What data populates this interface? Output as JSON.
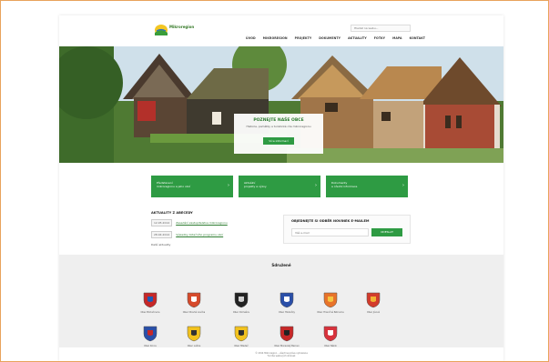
{
  "header": {
    "logo_text": "Mikroregion",
    "search_placeholder": "Hledat na webu...",
    "nav": [
      "ÚVOD",
      "MIKROREGION",
      "PROJEKTY",
      "DOKUMENTY",
      "AKTUALITY",
      "FOTKY",
      "MAPA",
      "KONTAKT"
    ]
  },
  "hero": {
    "title": "POZNEJTE NAŠE OBCE",
    "subtitle": "Historie, památky a turistické cíle mikroregionu",
    "button": "Více informací"
  },
  "tiles": [
    {
      "line1": "Představení",
      "line2": "mikroregionu a jeho obcí"
    },
    {
      "line1": "Aktuální",
      "line2": "projekty a výzvy"
    },
    {
      "line1": "Dokumenty",
      "line2": "a úřední informace"
    }
  ],
  "news": {
    "heading": "AKTUALITY Z ABECEDY",
    "items": [
      {
        "date": "12.05.2014",
        "title": "Zasedání zastupitelstva mikroregionu"
      },
      {
        "date": "28.04.2014",
        "title": "Výsledky dotačního programu obcí"
      }
    ],
    "more": "Další aktuality"
  },
  "newsletter": {
    "heading": "OBJEDNEJTE SI ODBĚR NOVINEK E-MAILEM",
    "placeholder": "Váš e-mail",
    "button": "ODESLAT"
  },
  "towns": {
    "heading": "Sdružené",
    "items": [
      {
        "name": "Obec Bohuňovice",
        "colors": [
          "#c62828",
          "#1e5bb5"
        ]
      },
      {
        "name": "Obec Dlouhá Loučka",
        "colors": [
          "#d64a2b",
          "#ffffff"
        ]
      },
      {
        "name": "Obec Domašov",
        "colors": [
          "#222222",
          "#cfcfcf"
        ]
      },
      {
        "name": "Obec Hlubočky",
        "colors": [
          "#2a4fa8",
          "#ffffff"
        ]
      },
      {
        "name": "Obec Hraničné Petrovice",
        "colors": [
          "#e8732a",
          "#f5c542"
        ]
      },
      {
        "name": "Obec Jívová",
        "colors": [
          "#d23b2b",
          "#f2b233"
        ]
      },
      {
        "name": "Obec Krnov",
        "colors": [
          "#2a4fa8",
          "#c62828"
        ]
      },
      {
        "name": "Obec Lužice",
        "colors": [
          "#f2c21e",
          "#333333"
        ]
      },
      {
        "name": "Obec Mladeč",
        "colors": [
          "#f2c21e",
          "#2f2f2f"
        ]
      },
      {
        "name": "Obec Moravský Beroun",
        "colors": [
          "#c62828",
          "#222222"
        ]
      },
      {
        "name": "Obec Náklo",
        "colors": [
          "#d8323c",
          "#ffffff"
        ]
      }
    ]
  },
  "footer": {
    "line1": "© 2014 Mikroregion – všechna práva vyhrazena",
    "line2": "Tvorba webových stránek"
  }
}
